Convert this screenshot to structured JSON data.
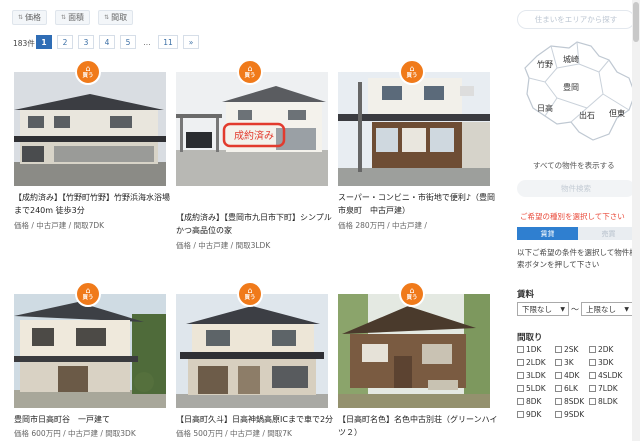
{
  "sort": {
    "price_label": "価格",
    "area_label": "面積",
    "layout_label": "間取"
  },
  "pagination": {
    "total": "183件",
    "pages": [
      "1",
      "2",
      "3",
      "4",
      "5",
      "...",
      "11",
      "»"
    ],
    "active": "1"
  },
  "listings": [
    {
      "badge": "買う",
      "title": "【成約済み】【竹野町竹野】竹野浜海水浴場まで240m 徒歩3分",
      "meta": "価格 / 中古戸建 / 間取7DK"
    },
    {
      "badge": "買う",
      "title": "【成約済み】【豊岡市九日市下町】シンプルかつ高品位の家",
      "meta": "価格 / 中古戸建 / 間取3LDK",
      "stamp": "成約済み"
    },
    {
      "badge": "買う",
      "title": "スーパー・コンビニ・市街地で便利♪（豊岡市泉町　中古戸建）",
      "meta": "価格 280万円 / 中古戸建 /"
    },
    {
      "badge": "買う",
      "title": "豊岡市日高町谷　一戸建て",
      "meta": "価格 600万円 / 中古戸建 / 間取3DK"
    },
    {
      "badge": "買う",
      "title": "【日高町久斗】日高神鍋高原ICまで車で2分",
      "meta": "価格 500万円 / 中古戸建 / 間取7K"
    },
    {
      "badge": "買う",
      "title": "【日高町名色】名色中古別荘（グリーンハイツ２）",
      "meta": ""
    }
  ],
  "sidebar": {
    "area_button": "住まいをエリアから探す",
    "map_labels": [
      "竹野",
      "城崎",
      "豊岡",
      "日高",
      "出石",
      "但東"
    ],
    "all_link": "すべての物件を表示する",
    "search_button": "物件検索",
    "kind_note": "ご希望の種別を選択して下さい",
    "tabs": [
      "賃貸",
      "売買"
    ],
    "guide": "以下ご希望の条件を選択して物件検索ボタンを押して下さい",
    "price_heading": "賃料",
    "price_min": "下限なし",
    "price_tilde": "～",
    "price_max": "上限なし",
    "layout_heading": "間取り",
    "layouts": [
      "1DK",
      "2SK",
      "2DK",
      "2LDK",
      "3K",
      "3DK",
      "3LDK",
      "4DK",
      "4SLDK",
      "5LDK",
      "6LK",
      "7LDK",
      "8DK",
      "8SDK",
      "8LDK",
      "9DK",
      "9SDK"
    ]
  },
  "colors": {
    "accent_orange": "#f07a1a",
    "pager_blue": "#2f6db5",
    "note_red": "#e94a3a"
  }
}
